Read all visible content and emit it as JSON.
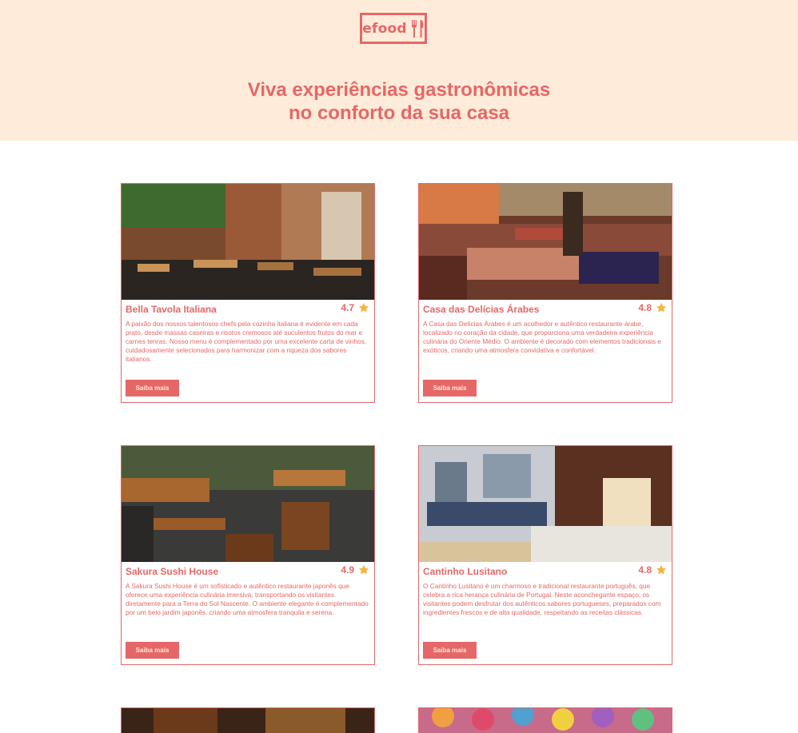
{
  "header": {
    "logo_text": "efood",
    "tagline_line1": "Viva experiências gastronômicas",
    "tagline_line2": "no conforto da sua casa"
  },
  "colors": {
    "primary": "#e66767",
    "hero_bg": "#ffebd9",
    "star": "#f5b43b"
  },
  "restaurants": [
    {
      "name": "Bella Tavola Italiana",
      "rating": "4.7",
      "description": "A paixão dos nossos talentosos chefs pela cozinha italiana é evidente em cada prato, desde massas caseiras e risotos cremosos até suculentos frutos do mar e carnes tenras. Nosso menu é complementado por uma excelente carta de vinhos, cuidadosamente selecionados para harmonizar com a riqueza dos sabores italianos.",
      "button": "Saiba mais"
    },
    {
      "name": "Casa das Delícias Árabes",
      "rating": "4.8",
      "description": "A Casa das Delícias Árabes é um acolhedor e autêntico restaurante árabe, localizado no coração da cidade, que proporciona uma verdadeira experiência culinária do Oriente Médio. O ambiente é decorado com elementos tradicionais e exóticos, criando uma atmosfera convidativa e confortável.",
      "button": "Saiba mais"
    },
    {
      "name": "Sakura Sushi House",
      "rating": "4.9",
      "description": "A Sakura Sushi House é um sofisticado e autêntico restaurante japonês que oferece uma experiência culinária imersiva, transportando os visitantes diretamente para a Terra do Sol Nascente. O ambiente elegante é complementado por um belo jardim japonês, criando uma atmosfera tranquila e serena.",
      "button": "Saiba mais"
    },
    {
      "name": "Cantinho Lusitano",
      "rating": "4.8",
      "description": "O Cantinho Lusitano é um charmoso e tradicional restaurante português, que celebra a rica herança culinária de Portugal. Neste aconchegante espaço, os visitantes podem desfrutar dos autênticos sabores portugueses, preparados com ingredientes frescos e de alta qualidade, respeitando as receitas clássicas.",
      "button": "Saiba mais"
    }
  ]
}
